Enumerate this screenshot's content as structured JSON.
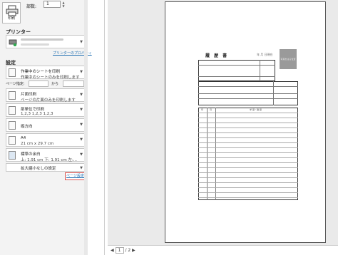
{
  "print": {
    "button_label": "印刷",
    "copies_label": "部数:",
    "copies_value": "1"
  },
  "printer": {
    "section_title": "プリンター",
    "properties_link": "プリンターのプロパティ"
  },
  "settings": {
    "section_title": "設定",
    "range": {
      "line1": "作業中のシートを印刷",
      "line2": "作業中のシートのみを印刷します"
    },
    "pages_label": "ページ指定:",
    "pages_to_label": "から",
    "sides": {
      "line1": "片面印刷",
      "line2": "ページの片面のみを印刷します"
    },
    "collate": {
      "line1": "部単位で印刷",
      "line2": "1,2,3    1,2,3    1,2,3"
    },
    "orientation": {
      "line1": "縦方向"
    },
    "paper": {
      "line1": "A4",
      "line2": "21 cm x 29.7 cm"
    },
    "margins": {
      "line1": "標準の余白",
      "line2": "上: 1.91 cm 下: 1.91 cm 左:..."
    },
    "scaling": {
      "line1": "拡大縮小なしの設定"
    },
    "page_setup_link": "ページ設定"
  },
  "preview": {
    "doc_title": "履 歴 書",
    "date_text": "年  月  日現在",
    "photo_label": "写真をはる位置",
    "section_header": "学 歴・職 歴",
    "col_year": "年",
    "col_month": "月"
  },
  "pager": {
    "current_page": "1",
    "total": "/ 2"
  },
  "colors": {
    "link": "#1f6fb2",
    "highlight_border": "#d9534f",
    "panel_bg": "#f3f3f3"
  }
}
